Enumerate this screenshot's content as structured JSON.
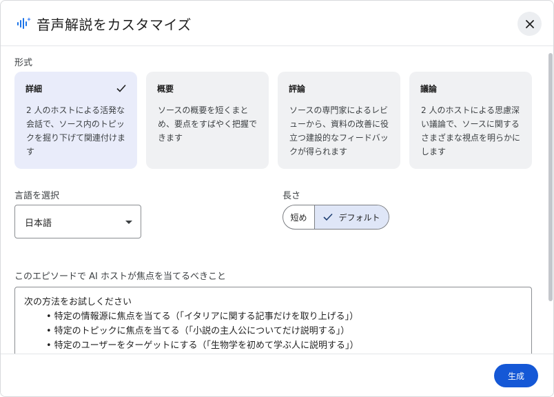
{
  "dialog": {
    "title": "音声解説をカスタマイズ",
    "close_label": "×"
  },
  "format": {
    "label": "形式",
    "cards": [
      {
        "title": "詳細",
        "desc": "2 人のホストによる活発な会話で、ソース内のトピックを掘り下げて関連付けます",
        "selected": true
      },
      {
        "title": "概要",
        "desc": "ソースの概要を短くまとめ、要点をすばやく把握できます",
        "selected": false
      },
      {
        "title": "評論",
        "desc": "ソースの専門家によるレビューから、資料の改善に役立つ建設的なフィードバックが得られます",
        "selected": false
      },
      {
        "title": "議論",
        "desc": "2 人のホストによる思慮深い議論で、ソースに関するさまざまな視点を明らかにします",
        "selected": false
      }
    ]
  },
  "language": {
    "label": "言語を選択",
    "value": "日本語"
  },
  "length": {
    "label": "長さ",
    "options": [
      "短め",
      "デフォルト"
    ],
    "selected": "デフォルト"
  },
  "focus": {
    "label": "このエピソードで AI ホストが焦点を当てるべきこと",
    "intro": "次の方法をお試しください",
    "examples": [
      "特定の情報源に焦点を当てる（「イタリアに関する記事だけを取り上げる」）",
      "特定のトピックに焦点を当てる（「小説の主人公についてだけ説明する」）",
      "特定のユーザーをターゲットにする（「生物学を初めて学ぶ人に説明する」）"
    ]
  },
  "footer": {
    "generate_label": "生成"
  },
  "colors": {
    "primary": "#1558d6",
    "selected_card": "#e9ecfa",
    "card": "#f0f1f3"
  }
}
